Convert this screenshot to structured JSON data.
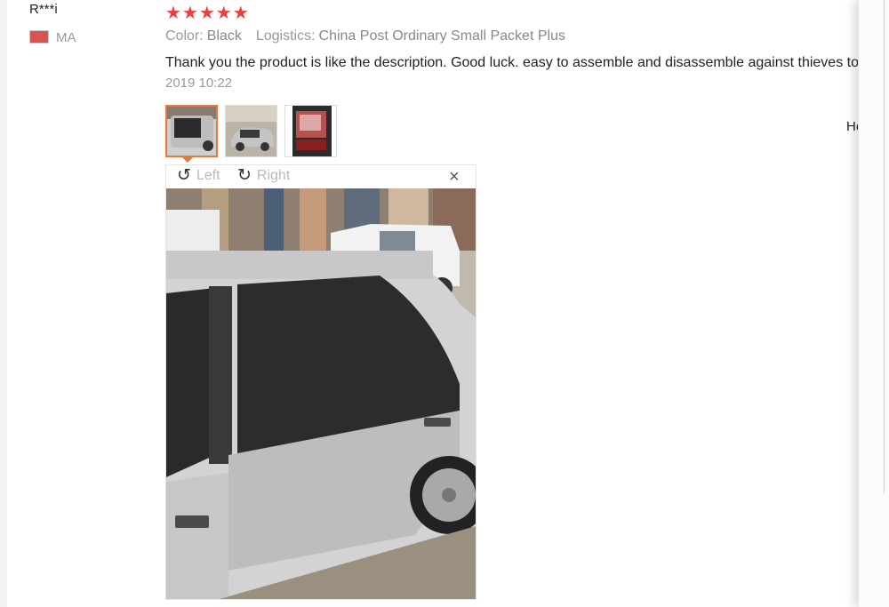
{
  "review": {
    "user_name": "R***i",
    "country": "MA",
    "stars": "★★★★★",
    "color_label": "Color:",
    "color_value": "Black",
    "logistics_label": "Logistics:",
    "logistics_value": "China Post Ordinary Small Packet Plus",
    "comment": "Thank you the product is like the description. Good luck. easy to assemble and disassemble against thieves to",
    "date": "2019 10:22",
    "helpful_label": "Helpf"
  },
  "viewer": {
    "rotate_left_label": "Left",
    "rotate_right_label": "Right",
    "close_glyph": "×",
    "rotate_left_glyph": "↺",
    "rotate_right_glyph": "↻"
  },
  "icons": {
    "flag": "morocco-flag-icon",
    "rotate_left": "rotate-left-icon",
    "rotate_right": "rotate-right-icon",
    "close": "close-icon"
  },
  "colors": {
    "star": "#f03e3e",
    "active_thumb_border": "#e8793a",
    "muted_text": "#999999"
  }
}
